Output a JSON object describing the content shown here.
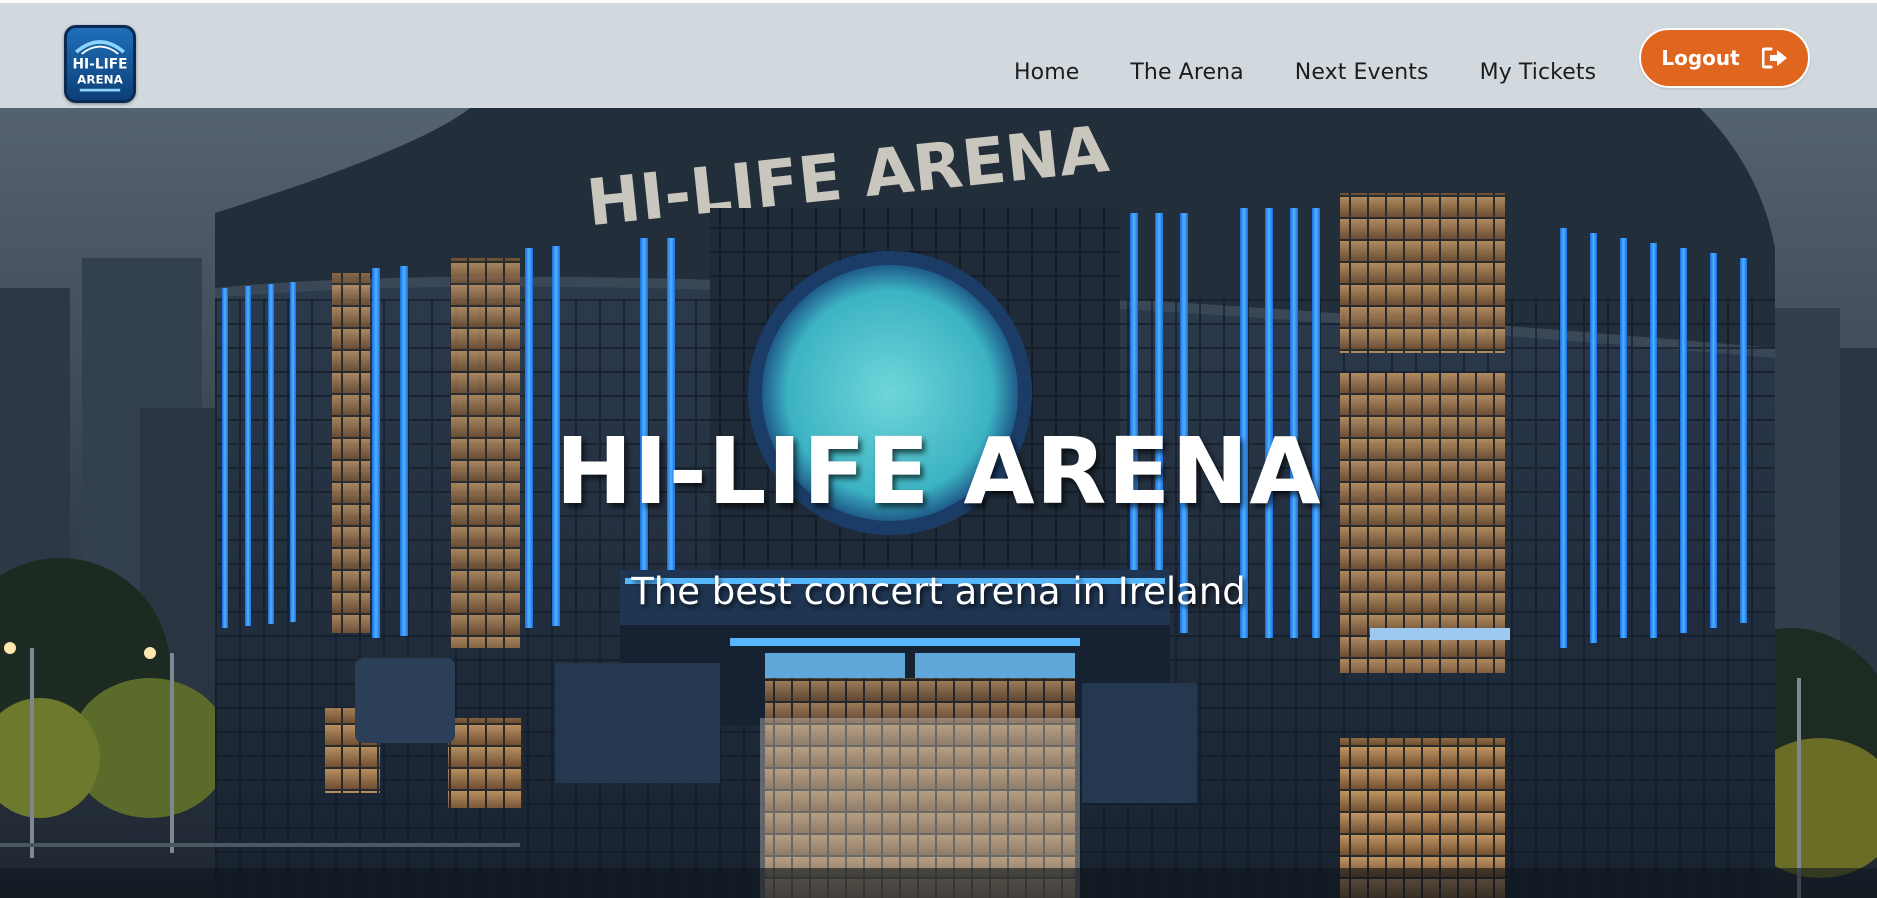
{
  "brand": {
    "logo_line1": "HI-LIFE",
    "logo_line2": "ARENA"
  },
  "nav": {
    "items": [
      {
        "label": "Home"
      },
      {
        "label": "The Arena"
      },
      {
        "label": "Next Events"
      },
      {
        "label": "My Tickets"
      }
    ],
    "logout_label": "Logout",
    "logout_icon": "sign-out-icon"
  },
  "hero": {
    "title": "HI-LIFE ARENA",
    "subtitle": "The best concert arena in Ireland",
    "building_sign": "HI-LIFE ARENA"
  },
  "colors": {
    "navbar_bg": "#d2d9de",
    "accent": "#e0661f",
    "text_dark": "#1c1c1c",
    "hero_text": "#ffffff"
  }
}
